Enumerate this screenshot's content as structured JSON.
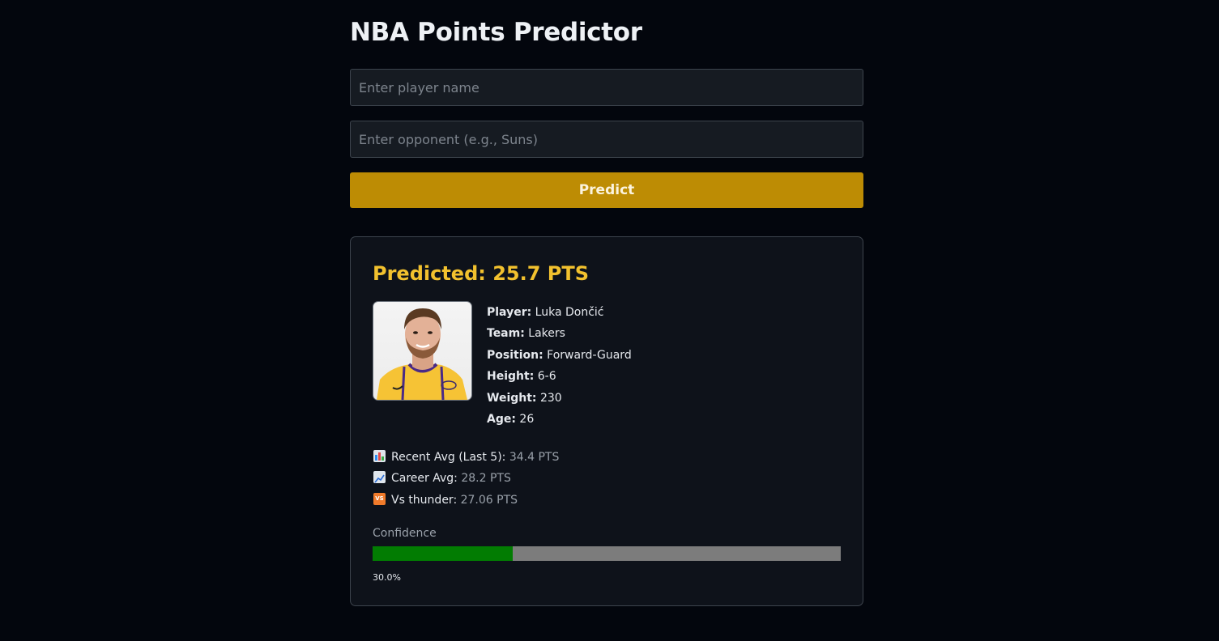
{
  "app": {
    "title": "NBA Points Predictor"
  },
  "form": {
    "player_placeholder": "Enter player name",
    "player_value": "",
    "opponent_placeholder": "Enter opponent (e.g., Suns)",
    "opponent_value": "",
    "predict_label": "Predict"
  },
  "result": {
    "predicted_text": "Predicted: 25.7 PTS",
    "photo_icon": "player-headshot",
    "player": {
      "label": "Player:",
      "value": "Luka Dončić"
    },
    "team": {
      "label": "Team:",
      "value": "Lakers"
    },
    "position": {
      "label": "Position:",
      "value": "Forward-Guard"
    },
    "height": {
      "label": "Height:",
      "value": "6-6"
    },
    "weight": {
      "label": "Weight:",
      "value": "230"
    },
    "age": {
      "label": "Age:",
      "value": "26"
    },
    "stats": {
      "recent": {
        "icon": "bar-chart-icon",
        "label": "Recent Avg (Last 5):",
        "value": "34.4 PTS"
      },
      "career": {
        "icon": "chart-increasing-icon",
        "label": "Career Avg:",
        "value": "28.2 PTS"
      },
      "vs": {
        "icon": "vs-icon",
        "label": "Vs thunder:",
        "value": "27.06 PTS"
      }
    },
    "confidence": {
      "label": "Confidence",
      "value": 0.3,
      "text": "30.0%"
    }
  },
  "colors": {
    "background": "#03060d",
    "accent": "#bd8c04",
    "predicted": "#f2c12e",
    "confidence_fill": "#027c02",
    "confidence_track": "#7c7c7c"
  }
}
